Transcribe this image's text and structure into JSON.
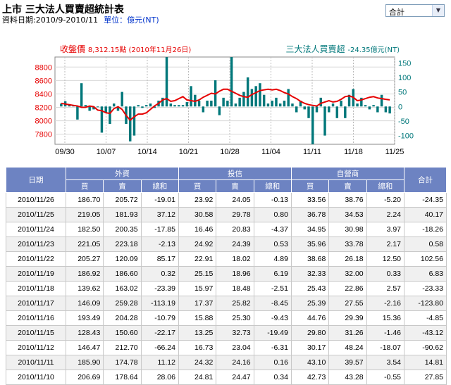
{
  "header": {
    "title": "上市 三大法人買賣超統計表",
    "date_label": "資料日期:2010/9-2010/11",
    "unit_label": "單位：億元(NT)",
    "select_value": "合計"
  },
  "legend": {
    "index_label": "收盤價",
    "index_value": "8,312.15點 (2010年11月26日)",
    "net_label": "三大法人買賣超",
    "net_value": "-24.35億元(NT)"
  },
  "chart_data": {
    "type": "bar+line",
    "x_labels": [
      "09/30",
      "10/07",
      "10/14",
      "10/21",
      "10/28",
      "11/04",
      "11/11",
      "11/18",
      "11/25"
    ],
    "left_axis": {
      "ticks": [
        7800,
        8000,
        8200,
        8400,
        8600,
        8800
      ],
      "range": [
        7650,
        8950
      ]
    },
    "right_axis": {
      "ticks": [
        150,
        100,
        50,
        0,
        -50,
        -100
      ],
      "range": [
        -130,
        170
      ]
    },
    "bars": [
      10,
      18,
      8,
      5,
      -45,
      80,
      5,
      -15,
      -10,
      0,
      -90,
      -20,
      -60,
      10,
      -15,
      50,
      -60,
      -120,
      -100,
      5,
      -5,
      5,
      10,
      -5,
      20,
      30,
      170,
      10,
      5,
      5,
      5,
      15,
      70,
      40,
      20,
      -20,
      20,
      20,
      90,
      -30,
      30,
      20,
      170,
      10,
      30,
      50,
      100,
      60,
      70,
      80,
      40,
      10,
      20,
      30,
      10,
      20,
      60,
      10,
      -20,
      20,
      -10,
      -40,
      -130,
      -20,
      30,
      -100,
      -20,
      10,
      -40,
      20,
      -40,
      40,
      60,
      10,
      30,
      5,
      -10,
      5,
      -20,
      40,
      -20,
      -24
    ],
    "line": [
      8260,
      8250,
      8240,
      8230,
      8220,
      8200,
      8200,
      8220,
      8210,
      8160,
      8150,
      8120,
      8110,
      8180,
      8210,
      8170,
      8080,
      8010,
      8060,
      8100,
      8100,
      8120,
      8170,
      8220,
      8260,
      8310,
      8330,
      8290,
      8300,
      8330,
      8360,
      8310,
      8300,
      8290,
      8310,
      8350,
      8380,
      8410,
      8400,
      8440,
      8470,
      8470,
      8440,
      8410,
      8380,
      8360,
      8350,
      8390,
      8420,
      8450,
      8460,
      8470,
      8460,
      8470,
      8450,
      8420,
      8400,
      8360,
      8330,
      8290,
      8260,
      8240,
      8230,
      8220,
      8260,
      8280,
      8300,
      8280,
      8290,
      8320,
      8360,
      8370,
      8350,
      8300,
      8310,
      8330,
      8350,
      8360,
      8340,
      8330,
      8320,
      8312
    ]
  },
  "table": {
    "headers": {
      "date": "日期",
      "foreign": "外資",
      "trust": "投信",
      "dealer": "自營商",
      "total": "合計",
      "buy": "買",
      "sell": "賣",
      "net": "總和"
    },
    "rows": [
      [
        "2010/11/26",
        "186.70",
        "205.72",
        "-19.01",
        "23.92",
        "24.05",
        "-0.13",
        "33.56",
        "38.76",
        "-5.20",
        "-24.35"
      ],
      [
        "2010/11/25",
        "219.05",
        "181.93",
        "37.12",
        "30.58",
        "29.78",
        "0.80",
        "36.78",
        "34.53",
        "2.24",
        "40.17"
      ],
      [
        "2010/11/24",
        "182.50",
        "200.35",
        "-17.85",
        "16.46",
        "20.83",
        "-4.37",
        "34.95",
        "30.98",
        "3.97",
        "-18.26"
      ],
      [
        "2010/11/23",
        "221.05",
        "223.18",
        "-2.13",
        "24.92",
        "24.39",
        "0.53",
        "35.96",
        "33.78",
        "2.17",
        "0.58"
      ],
      [
        "2010/11/22",
        "205.27",
        "120.09",
        "85.17",
        "22.91",
        "18.02",
        "4.89",
        "38.68",
        "26.18",
        "12.50",
        "102.56"
      ],
      [
        "2010/11/19",
        "186.92",
        "186.60",
        "0.32",
        "25.15",
        "18.96",
        "6.19",
        "32.33",
        "32.00",
        "0.33",
        "6.83"
      ],
      [
        "2010/11/18",
        "139.62",
        "163.02",
        "-23.39",
        "15.97",
        "18.48",
        "-2.51",
        "25.43",
        "22.86",
        "2.57",
        "-23.33"
      ],
      [
        "2010/11/17",
        "146.09",
        "259.28",
        "-113.19",
        "17.37",
        "25.82",
        "-8.45",
        "25.39",
        "27.55",
        "-2.16",
        "-123.80"
      ],
      [
        "2010/11/16",
        "193.49",
        "204.28",
        "-10.79",
        "15.88",
        "25.30",
        "-9.43",
        "44.76",
        "29.39",
        "15.36",
        "-4.85"
      ],
      [
        "2010/11/15",
        "128.43",
        "150.60",
        "-22.17",
        "13.25",
        "32.73",
        "-19.49",
        "29.80",
        "31.26",
        "-1.46",
        "-43.12"
      ],
      [
        "2010/11/12",
        "146.47",
        "212.70",
        "-66.24",
        "16.73",
        "23.04",
        "-6.31",
        "30.17",
        "48.24",
        "-18.07",
        "-90.62"
      ],
      [
        "2010/11/11",
        "185.90",
        "174.78",
        "11.12",
        "24.32",
        "24.16",
        "0.16",
        "43.10",
        "39.57",
        "3.54",
        "14.81"
      ],
      [
        "2010/11/10",
        "206.69",
        "178.64",
        "28.06",
        "24.81",
        "24.47",
        "0.34",
        "42.73",
        "43.28",
        "-0.55",
        "27.85"
      ]
    ]
  }
}
